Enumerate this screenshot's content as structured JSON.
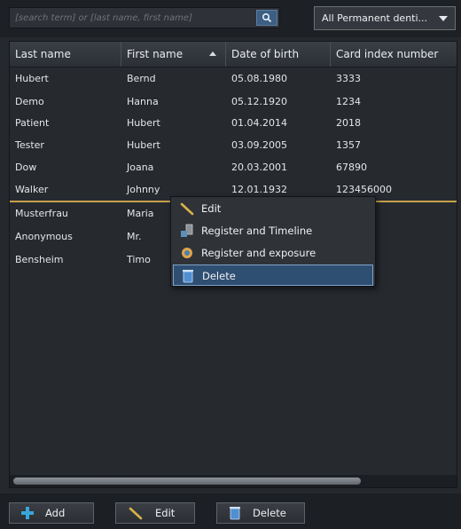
{
  "search": {
    "placeholder": "[search term] or [last name, first name]"
  },
  "filter": {
    "selected": "All Permanent denti..."
  },
  "columns": [
    "Last name",
    "First name",
    "Date of birth",
    "Card index number"
  ],
  "rows": [
    [
      "Hubert",
      "Bernd",
      "05.08.1980",
      "3333"
    ],
    [
      "Demo",
      "Hanna",
      "05.12.1920",
      "1234"
    ],
    [
      "Patient",
      "Hubert",
      "01.04.2014",
      "2018"
    ],
    [
      "Tester",
      "Hubert",
      "03.09.2005",
      "1357"
    ],
    [
      "Dow",
      "Joana",
      "20.03.2001",
      "67890"
    ],
    [
      "Walker",
      "Johnny",
      "12.01.1932",
      "123456000"
    ],
    [
      "Musterfrau",
      "Maria",
      "",
      ""
    ],
    [
      "Anonymous",
      "Mr.",
      "",
      ""
    ],
    [
      "Bensheim",
      "Timo",
      "",
      ""
    ]
  ],
  "context_menu": {
    "items": [
      {
        "label": "Edit",
        "icon": "pencil-icon"
      },
      {
        "label": "Register and Timeline",
        "icon": "register-timeline-icon"
      },
      {
        "label": "Register and exposure",
        "icon": "register-exposure-icon"
      },
      {
        "label": "Delete",
        "icon": "trash-icon"
      }
    ],
    "highlighted": "Delete"
  },
  "footer": {
    "add_label": "Add",
    "edit_label": "Edit",
    "delete_label": "Delete"
  },
  "colors": {
    "accent": "#c8a24a",
    "highlight": "#2f4f72",
    "add_icon": "#39a6d8"
  }
}
